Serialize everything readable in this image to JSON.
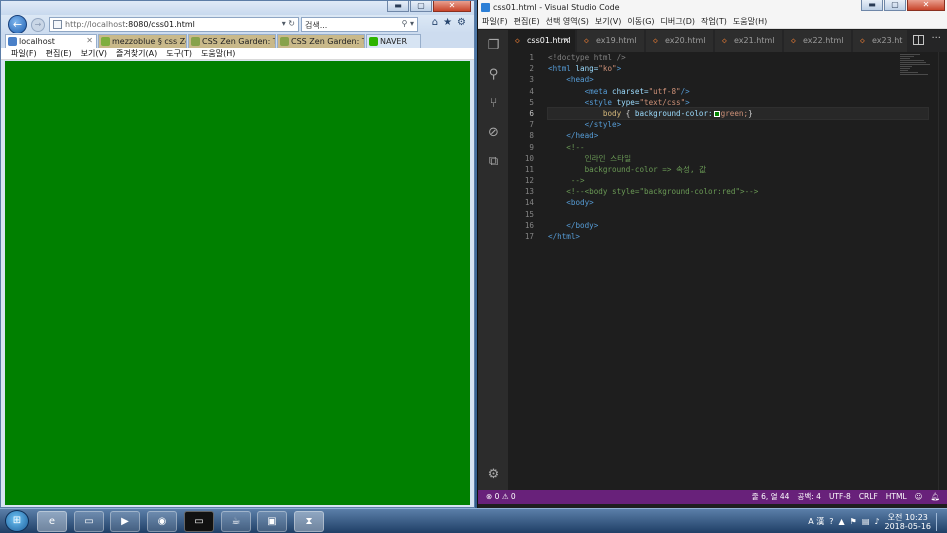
{
  "ie": {
    "url_host": "http://localhost",
    "url_rest": ":8080/css01.html",
    "search_placeholder": "검색...",
    "tabs": [
      {
        "label": "localhost",
        "color": "#4a80c8"
      },
      {
        "label": "mezzoblue § css Zen...",
        "color": "#7fae3e"
      },
      {
        "label": "CSS Zen Garden: The...",
        "color": "#88a24b"
      },
      {
        "label": "CSS Zen Garden: The...",
        "color": "#88a24b"
      },
      {
        "label": "NAVER",
        "color": "#2db400"
      }
    ],
    "menu": [
      "파일(F)",
      "편집(E)",
      "보기(V)",
      "즐겨찾기(A)",
      "도구(T)",
      "도움말(H)"
    ],
    "page_background": "green"
  },
  "vscode": {
    "title": "css01.html - Visual Studio Code",
    "menu": [
      "파일(F)",
      "편집(E)",
      "선택 영역(S)",
      "보기(V)",
      "이동(G)",
      "디버그(D)",
      "작업(T)",
      "도움말(H)"
    ],
    "tabs": [
      "css01.html",
      "ex19.html",
      "ex20.html",
      "ex21.html",
      "ex22.html",
      "ex23.ht"
    ],
    "code": {
      "l1": "<!doctype html />",
      "l2_tag": "<html",
      "l2_attr": " lang=",
      "l2_val": "\"ko\"",
      "l2_end": ">",
      "l3": "<head>",
      "l4_tag": "<meta",
      "l4_attr": " charset=",
      "l4_val": "\"utf-8\"",
      "l4_end": "/>",
      "l5_tag": "<style",
      "l5_attr": " type=",
      "l5_val": "\"text/css\"",
      "l5_end": ">",
      "l6_sel": "body",
      "l6_open": " { ",
      "l6_prop": "background-color:",
      "l6_val": "green;",
      "l6_close": "}",
      "l7": "</style>",
      "l8": "</head>",
      "l9": "<!--",
      "l10": "인라인 스타일",
      "l11": "background-color => 속성, 값",
      "l12": "-->",
      "l13": "<!--<body style=\"background-color:red\">-->",
      "l14": "<body>",
      "l15": "",
      "l16": "</body>",
      "l17": "</html>"
    },
    "line_numbers": [
      "1",
      "2",
      "3",
      "4",
      "5",
      "6",
      "7",
      "8",
      "9",
      "10",
      "11",
      "12",
      "13",
      "14",
      "15",
      "16",
      "17"
    ],
    "status": {
      "problems": "⊗ 0 ⚠ 0",
      "position": "줄 6, 열 44",
      "spaces": "공백: 4",
      "encoding": "UTF-8",
      "eol": "CRLF",
      "language": "HTML"
    }
  },
  "tray": {
    "ime": "A 漢",
    "time": "오전 10:23",
    "date": "2018-05-16"
  }
}
